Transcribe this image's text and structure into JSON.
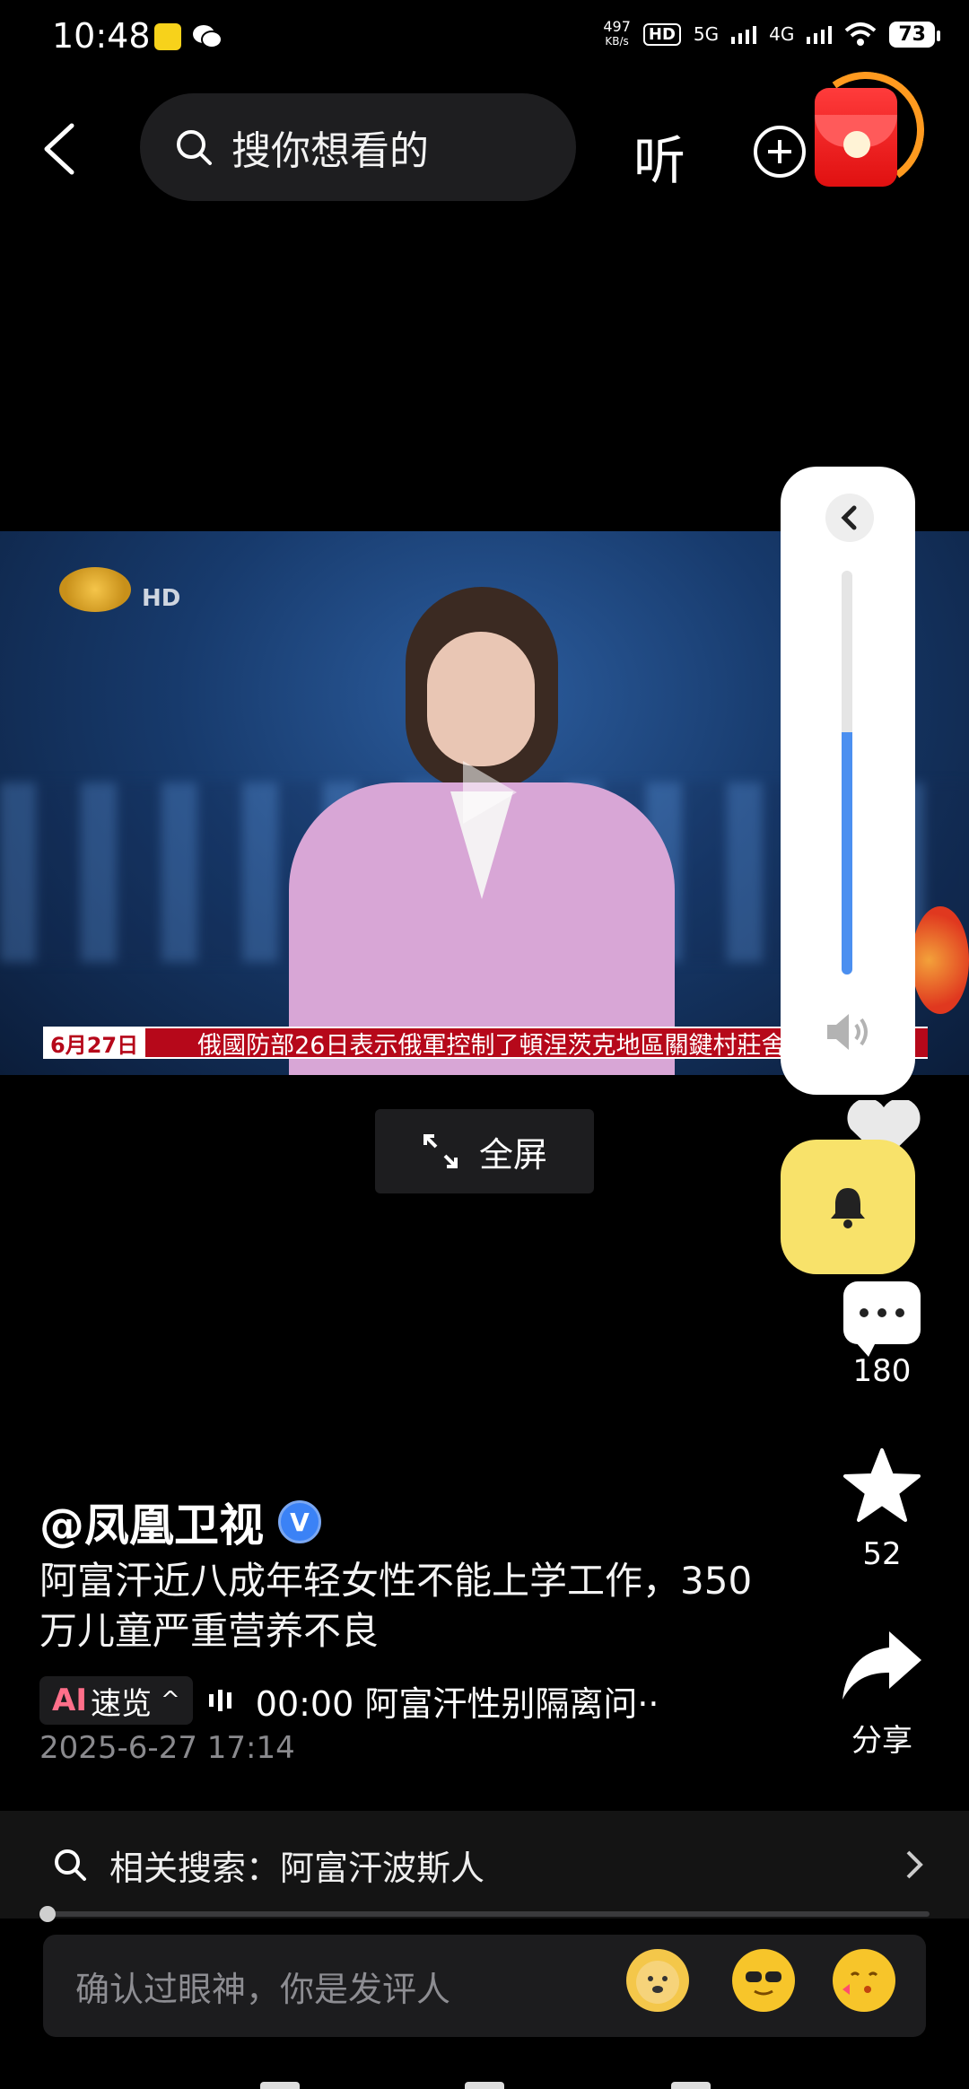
{
  "status_bar": {
    "time": "10:48",
    "net_speed_value": "497",
    "net_speed_unit": "KB/s",
    "hd_label": "HD",
    "network_5g": "5G",
    "network_4g": "4G",
    "battery": "73"
  },
  "top_bar": {
    "search_placeholder": "搜你想看的",
    "listen_label": "听"
  },
  "video": {
    "hd_label": "HD",
    "ticker_date": "6月27日",
    "ticker_text": "俄國防部26日表示俄軍控制了頓涅茨克地區關鍵村莊舍"
  },
  "fullscreen_label": "全屏",
  "rail": {
    "comment_count": "180",
    "star_count": "52",
    "share_label": "分享"
  },
  "post": {
    "author": "@凤凰卫视",
    "verified_mark": "V",
    "caption": "阿富汗近八成年轻女性不能上学工作，350万儿童严重营养不良",
    "ai_mark": "AI",
    "ai_label": "速览",
    "ai_caret": "^",
    "ai_summary": "00:00 阿富汗性别隔离问··",
    "date": "2025-6-27 17:14"
  },
  "related_search": {
    "text": "相关搜索：阿富汗波斯人"
  },
  "comment_input": {
    "placeholder": "确认过眼神，你是发评人"
  },
  "volume": {
    "level": 0.6,
    "accent": "#4b8ff0"
  },
  "colors": {
    "bell_bg": "#f8e26a",
    "ticker_red": "#b6081a"
  }
}
